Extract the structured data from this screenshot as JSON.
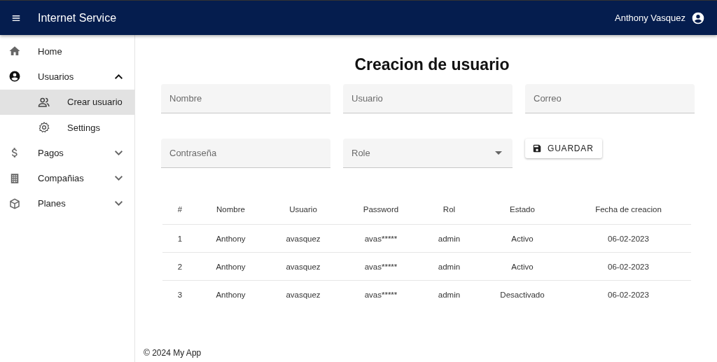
{
  "app_bar": {
    "title": "Internet Service",
    "user": "Anthony Vasquez"
  },
  "sidebar": {
    "items": [
      {
        "label": "Home",
        "selected": false
      },
      {
        "label": "Usuarios",
        "selected": false,
        "expanded": true,
        "children": [
          {
            "label": "Crear usuario",
            "selected": true
          },
          {
            "label": "Settings",
            "selected": false
          }
        ]
      },
      {
        "label": "Pagos",
        "selected": false,
        "expanded": false
      },
      {
        "label": "Compañias",
        "selected": false,
        "expanded": false
      },
      {
        "label": "Planes",
        "selected": false,
        "expanded": false
      }
    ]
  },
  "page_title": "Creacion de usuario",
  "form": {
    "fields": [
      {
        "kind": "text",
        "placeholder": "Nombre"
      },
      {
        "kind": "text",
        "placeholder": "Usuario"
      },
      {
        "kind": "text",
        "placeholder": "Correo"
      },
      {
        "kind": "text",
        "placeholder": "Contraseña"
      },
      {
        "kind": "select",
        "placeholder": "Role"
      }
    ],
    "save_button": "GUARDAR"
  },
  "table": {
    "columns": [
      "#",
      "Nombre",
      "Usuario",
      "Password",
      "Rol",
      "Estado",
      "Fecha de creacion"
    ],
    "rows": [
      [
        "1",
        "Anthony",
        "avasquez",
        "avas*****",
        "admin",
        "Activo",
        "06-02-2023"
      ],
      [
        "2",
        "Anthony",
        "avasquez",
        "avas*****",
        "admin",
        "Activo",
        "06-02-2023"
      ],
      [
        "3",
        "Anthony",
        "avasquez",
        "avas*****",
        "admin",
        "Desactivado",
        "06-02-2023"
      ]
    ]
  },
  "footer": "© 2024 My App"
}
